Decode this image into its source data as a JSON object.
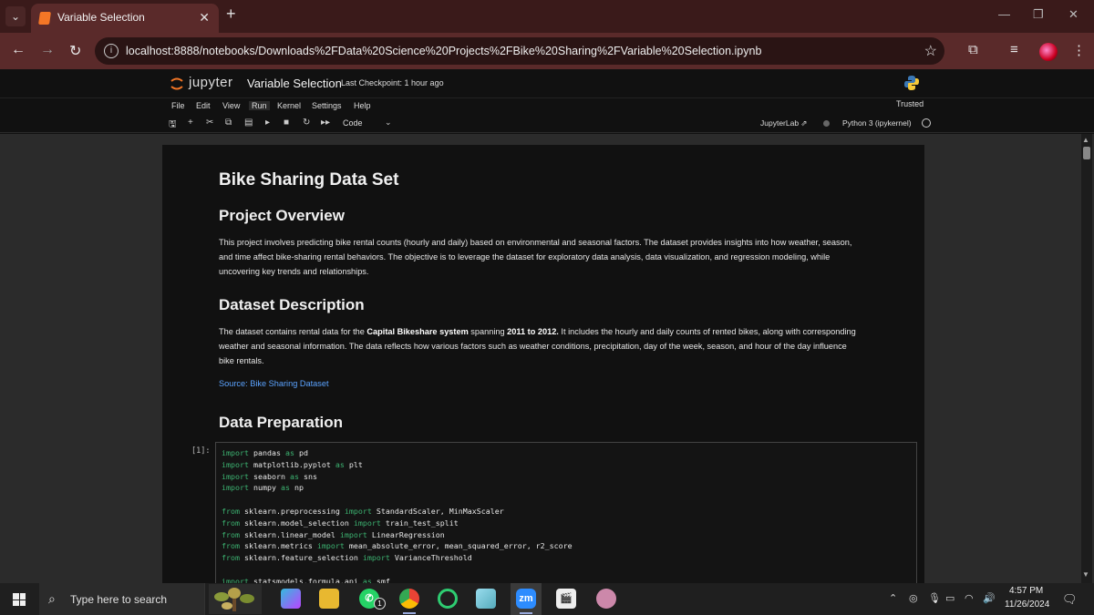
{
  "browser": {
    "tab_title": "Variable Selection",
    "url": "localhost:8888/notebooks/Downloads%2FData%20Science%20Projects%2FBike%20Sharing%2FVariable%20Selection.ipynb"
  },
  "jupyter": {
    "logo_text": "jupyter",
    "notebook_title": "Variable Selection",
    "checkpoint": "Last Checkpoint: 1 hour ago",
    "trusted": "Trusted",
    "menu": [
      "File",
      "Edit",
      "View",
      "Run",
      "Kernel",
      "Settings",
      "Help"
    ],
    "active_menu": "Run",
    "cell_type": "Code",
    "jupyterlab_link": "JupyterLab",
    "kernel": "Python 3 (ipykernel)"
  },
  "notebook": {
    "title": "Bike Sharing Data Set",
    "overview_heading": "Project Overview",
    "overview_lines": [
      "This project involves predicting bike rental counts (hourly and daily) based on environmental and seasonal factors. The dataset provides insights into how weather, season,",
      "and time affect bike-sharing rental behaviors. The objective is to leverage the dataset for exploratory data analysis, data visualization, and regression modeling, while",
      "uncovering key trends and relationships."
    ],
    "dataset_heading": "Dataset Description",
    "dataset_line1_a": "The dataset contains rental data for the ",
    "dataset_line1_b": "Capital Bikeshare system",
    "dataset_line1_c": " spanning ",
    "dataset_line1_d": "2011 to 2012.",
    "dataset_line1_e": " It includes the hourly and daily counts of rented bikes, along with corresponding",
    "dataset_lines_rest": [
      "weather and seasonal information. The data reflects how various factors such as weather conditions, precipitation, day of the week, season, and hour of the day influence",
      "bike rentals."
    ],
    "source_link": "Source: Bike Sharing Dataset",
    "prep_heading": "Data Preparation",
    "prompt": "[1]:"
  },
  "taskbar": {
    "search_placeholder": "Type here to search",
    "time": "4:57 PM",
    "date": "11/26/2024",
    "whatsapp_badge": "1"
  }
}
